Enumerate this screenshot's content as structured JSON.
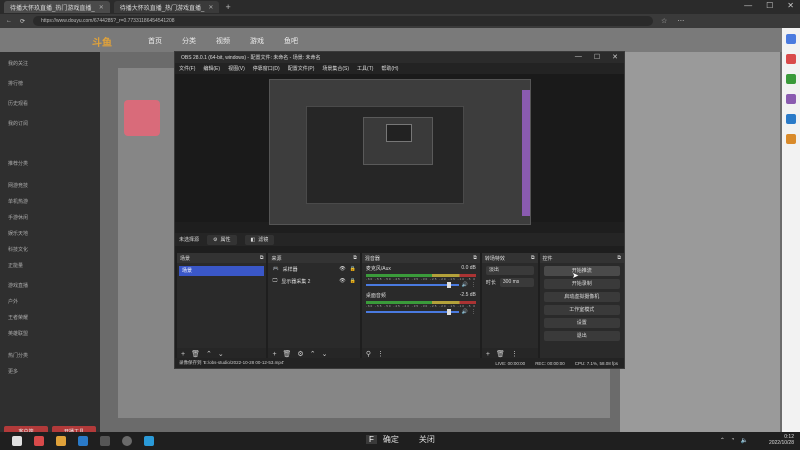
{
  "browser": {
    "tabs": [
      {
        "label": "待播大怀玖直播_热门游戏直播_",
        "active": true
      },
      {
        "label": "待播大怀玖直播_热门游戏直播_",
        "active": false
      }
    ],
    "url": "https://www.douyu.com/6744285?_r=0.77331186454541208"
  },
  "site": {
    "logo": "斗鱼",
    "nav": [
      "首页",
      "分类",
      "视频",
      "游戏",
      "鱼吧"
    ],
    "left_items": [
      "我的关注",
      "排行榜",
      "历史观看",
      "我的订阅",
      "推荐分类",
      "网游竞技",
      "单机热游",
      "手游休闲",
      "娱乐天地",
      "科技文化",
      "正能量",
      "游戏直播",
      "户外",
      "王者荣耀",
      "英雄联盟",
      "热门分类",
      "更多"
    ],
    "left_buttons": [
      "客户端",
      "开播工具"
    ]
  },
  "obs": {
    "title": "OBS 28.0.1 (64-bit, windows) - 配置文件: 未命名 - 场景: 未命名",
    "menu": [
      "文件(F)",
      "编辑(E)",
      "视图(V)",
      "停靠窗口(D)",
      "配置文件(P)",
      "场景集合(S)",
      "工具(T)",
      "帮助(H)"
    ],
    "source_bar": {
      "no_source": "未选择源",
      "properties": "属性",
      "filters": "滤镜"
    },
    "docks": {
      "scenes": {
        "title": "场景",
        "items": [
          "场景"
        ]
      },
      "sources": {
        "title": "来源",
        "items": [
          "采样器",
          "显示器采集 2"
        ]
      },
      "mixer": {
        "title": "混音器",
        "channels": [
          {
            "name": "麦克风/Aux",
            "db": "0.0 dB"
          },
          {
            "name": "桌面音频",
            "db": "-2.5 dB"
          }
        ],
        "ticks": "-60 -55 -50 -45 -40 -35 -30 -25 -20 -15 -10 -5 0"
      },
      "transitions": {
        "title": "转场特效",
        "type": "淡出",
        "duration_label": "时长",
        "duration": "300 ms"
      },
      "controls": {
        "title": "控件",
        "buttons": [
          "开始推流",
          "开始录制",
          "启动虚拟摄像机",
          "工作室模式",
          "设置",
          "退出"
        ]
      }
    },
    "status": {
      "saved": "录像保存到 'E:/obs-studio/2022-10-28 00-12-53.mp4'",
      "live": "LIVE: 00:00:00",
      "rec": "REC: 00:00:00",
      "cpu": "CPU: 7.1%, 58.08 fps"
    }
  },
  "taskbar": {
    "key_hint": "F",
    "ok_label": "确定",
    "close_label": "关闭",
    "time": "0:12",
    "date": "2022/10/28"
  }
}
